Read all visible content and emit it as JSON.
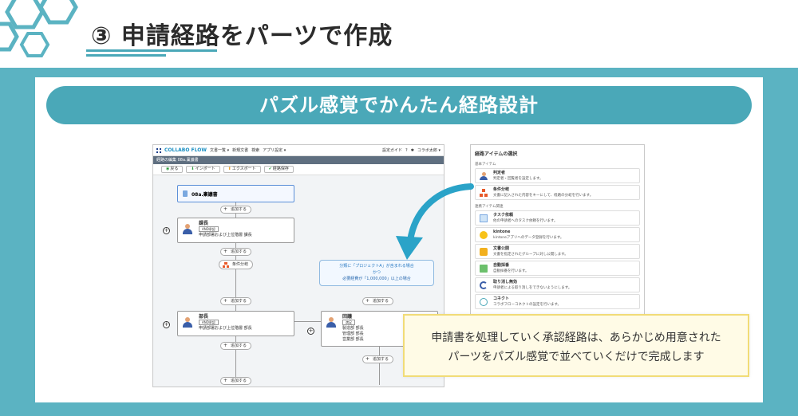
{
  "slide": {
    "title": "③ 申請経路をパーツで作成",
    "banner": "パズル感覚でかんたん経路設計",
    "note_line1": "申請書を処理していく承認経路は、あらかじめ用意された",
    "note_line2": "パーツをパズル感覚で並べていくだけで完成します"
  },
  "colors": {
    "accent": "#4aa8b8",
    "band": "#5bb3c2",
    "note_bg": "#fffbe6"
  },
  "app": {
    "logo": "COLLABO FLOW",
    "nav": [
      "文書一覧 ▾",
      "新規文書",
      "検索",
      "アプリ設定 ▾"
    ],
    "guide": "設定ガイド",
    "help": "?",
    "settings_icon": "gear-icon",
    "user": "コラボ太郎 ▾",
    "breadcrumb": "経路の編集 08a.稟議書",
    "toolbar": {
      "back": "戻る",
      "import": "インポート",
      "export": "エクスポート",
      "save": "経路保存"
    },
    "doc_name": "08a.稟議書",
    "add_label": "追加する",
    "branch_label": "条件分岐",
    "condition_line1": "分類に「プロジェクトA」が含まれる場合",
    "condition_line2": "かつ",
    "condition_line3": "必要経費が「1,000,000」以上の場合",
    "steps": [
      {
        "title": "課長",
        "tag": "AND承認",
        "desc": "申請部署および上位階層 課長"
      },
      {
        "title": "部長",
        "tag": "AND承認",
        "desc": "申請部署および上位階層 部長"
      }
    ],
    "group_step": {
      "title": "回議",
      "tag": "満足",
      "lines": [
        "製造部 部長",
        "管理部 部長",
        "営業部 部長"
      ]
    }
  },
  "palette": {
    "title": "経路アイテムの選択",
    "section_basic": "基本アイテム",
    "section_adv": "連携アイテム関連",
    "basic_items": [
      {
        "name": "判定者",
        "desc": "判定者・回覧者を設定します。",
        "icon": "person-icon"
      },
      {
        "name": "条件分岐",
        "desc": "文書に記入された内容をキーにして、経路の分岐を行います。",
        "icon": "branch-icon"
      }
    ],
    "adv_items": [
      {
        "name": "タスク依頼",
        "desc": "他の申請者へのタスク依頼を行います。",
        "icon": "task-icon"
      },
      {
        "name": "kintone",
        "desc": "kintoneアプリへのデータ登録を行います。",
        "icon": "kintone-icon"
      },
      {
        "name": "文書公開",
        "desc": "文書を指定されたグループに対し公開します。",
        "icon": "lock-icon"
      },
      {
        "name": "自動採番",
        "desc": "自動採番を行います。",
        "icon": "auto-number-icon"
      },
      {
        "name": "取り消し無効",
        "desc": "申請者による取り消しをできないようにします。",
        "icon": "undo-icon"
      },
      {
        "name": "コネクト",
        "desc": "コラボフローコネクトの設定を行います。",
        "icon": "connect-icon"
      }
    ]
  }
}
